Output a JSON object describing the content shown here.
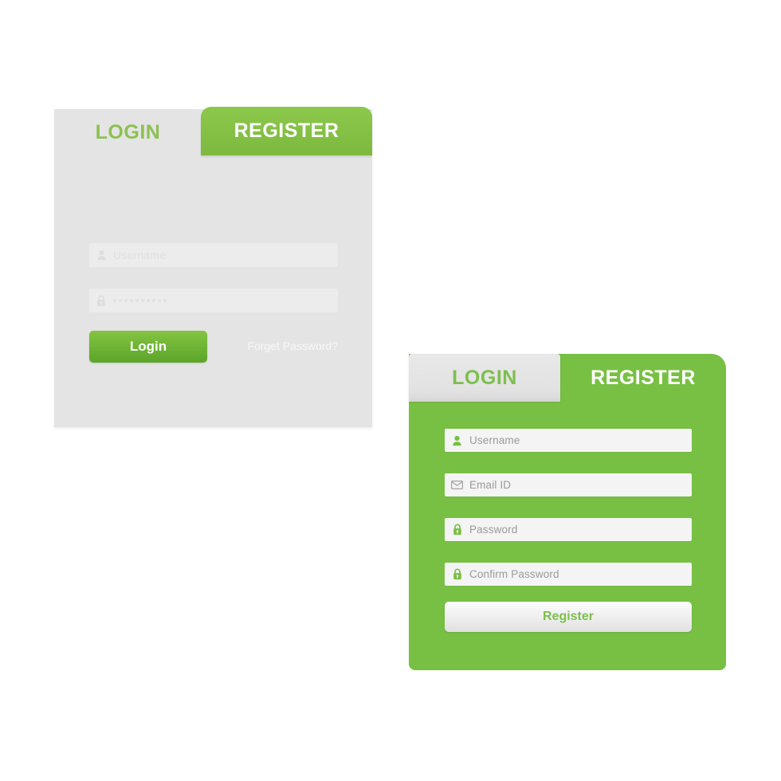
{
  "colors": {
    "green": "#78c043",
    "green_tab_top": "#8cc84b",
    "green_tab_bottom": "#7db93e",
    "login_button_top": "#83c441",
    "login_button_bottom": "#5ca52a",
    "card_gray": "#e4e4e4",
    "field_gray": "#ececec",
    "field_white": "#f4f4f4",
    "tab_text_green": "#7cbf4d",
    "placeholder_gray": "#9a9a9a",
    "page_background": "#ffffff"
  },
  "login_card": {
    "tabs": [
      {
        "id": "login",
        "label": "LOGIN",
        "active": true
      },
      {
        "id": "register",
        "label": "REGISTER",
        "active": false
      }
    ],
    "fields": [
      {
        "name": "username",
        "icon": "user-icon",
        "placeholder": "Username",
        "value": "",
        "type": "text"
      },
      {
        "name": "password",
        "icon": "lock-icon",
        "placeholder": "",
        "value": "••••••••••",
        "masked_char_count": 10,
        "type": "password"
      }
    ],
    "submit_label": "Login",
    "forget_link_label": "Forget Password?"
  },
  "register_card": {
    "tabs": [
      {
        "id": "login",
        "label": "LOGIN",
        "active": false
      },
      {
        "id": "register",
        "label": "REGISTER",
        "active": true
      }
    ],
    "fields": [
      {
        "name": "username",
        "icon": "user-icon",
        "placeholder": "Username",
        "value": "",
        "type": "text"
      },
      {
        "name": "email",
        "icon": "envelope-icon",
        "placeholder": "Email ID",
        "value": "",
        "type": "email"
      },
      {
        "name": "password",
        "icon": "lock-icon",
        "placeholder": "Password",
        "value": "",
        "type": "password"
      },
      {
        "name": "confirm-password",
        "icon": "lock-icon",
        "placeholder": "Confirm Password",
        "value": "",
        "type": "password"
      }
    ],
    "submit_label": "Register"
  }
}
